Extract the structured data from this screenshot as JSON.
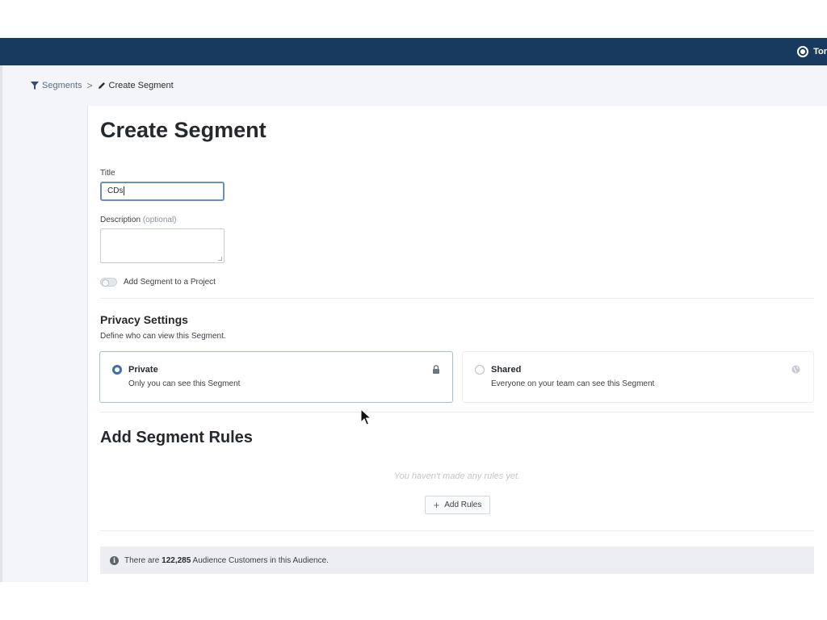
{
  "topbar": {
    "user_name": "Tor",
    "bg_color": "#173a5e"
  },
  "breadcrumb": {
    "segments_label": "Segments",
    "separator": ">",
    "current_label": "Create Segment"
  },
  "page": {
    "title": "Create Segment"
  },
  "form": {
    "title_label": "Title",
    "title_value": "CDs",
    "description_label": "Description",
    "description_optional": "(optional)",
    "description_value": "",
    "project_toggle_label": "Add Segment to a Project",
    "project_toggle_on": false
  },
  "privacy": {
    "title": "Privacy Settings",
    "subtitle": "Define who can view this Segment.",
    "options": [
      {
        "label": "Private",
        "description": "Only you can see this Segment",
        "selected": true,
        "icon": "lock-icon"
      },
      {
        "label": "Shared",
        "description": "Everyone on your team can see this Segment",
        "selected": false,
        "icon": "globe-icon"
      }
    ]
  },
  "rules": {
    "title": "Add Segment Rules",
    "empty_text": "You haven't made any rules yet.",
    "add_button_label": "Add Rules"
  },
  "audience_info": {
    "prefix": "There are",
    "count": "122,285",
    "suffix": "Audience Customers in this Audience."
  },
  "colors": {
    "accent": "#3f6fa8",
    "link": "#5b6f86"
  }
}
